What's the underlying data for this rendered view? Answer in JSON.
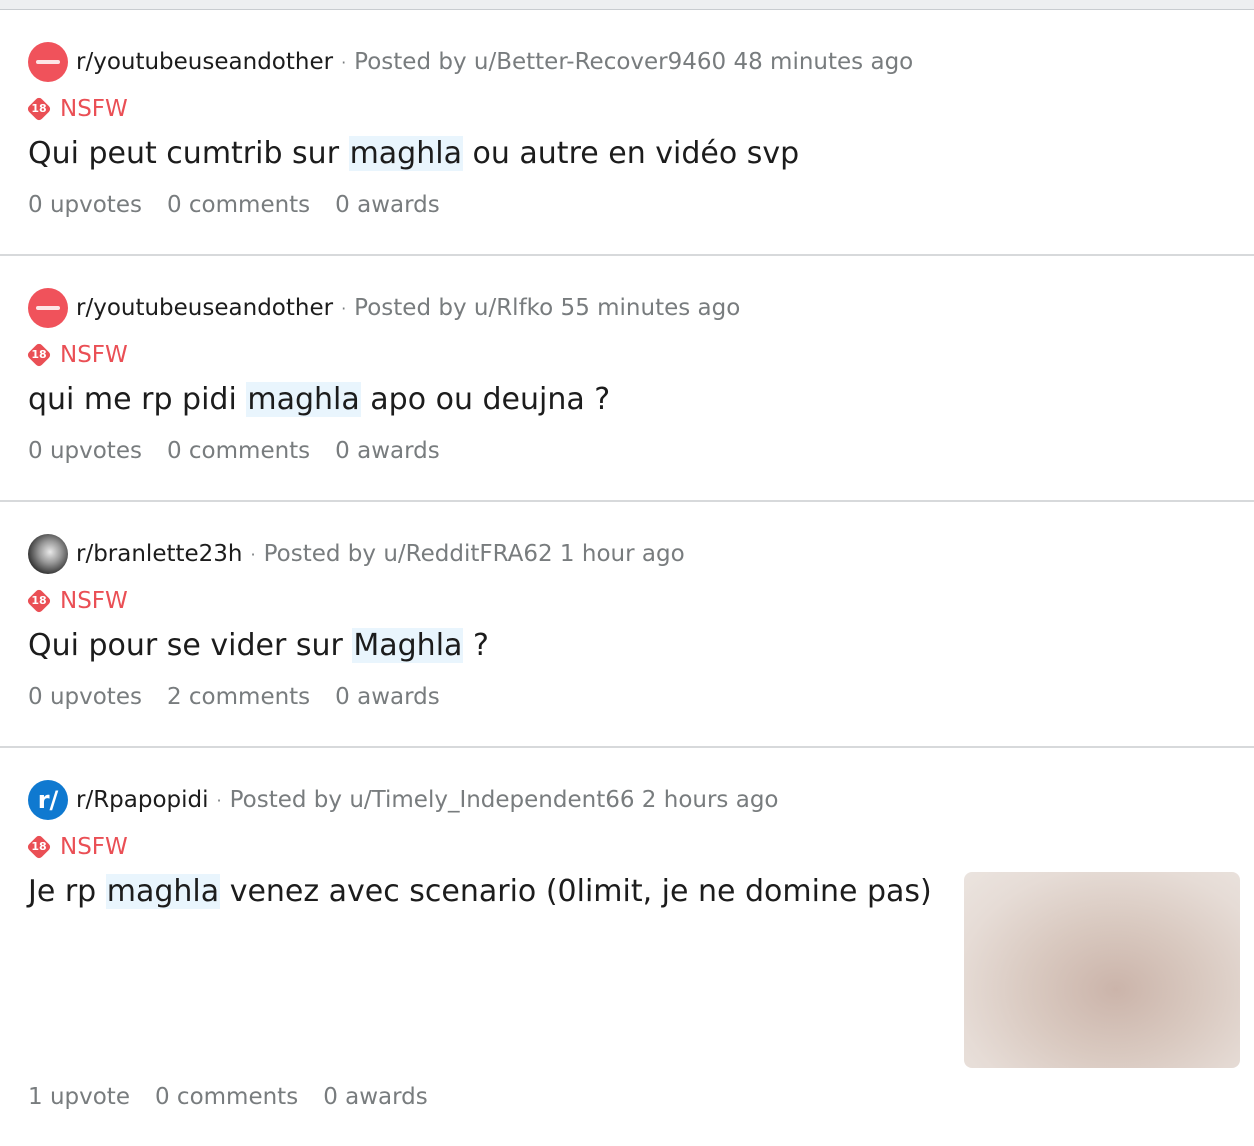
{
  "posts": [
    {
      "subreddit": "r/youtubeuseandother",
      "posted_by": "Posted by u/Better-Recover9460 48 minutes ago",
      "nsfw_badge": "18",
      "nsfw_label": "NSFW",
      "title_before": "Qui peut cumtrib sur ",
      "title_highlight": "maghla",
      "title_after": " ou autre en vidéo svp",
      "upvotes": "0 upvotes",
      "comments": "0 comments",
      "awards": "0 awards",
      "avatar_color": "#f0525b"
    },
    {
      "subreddit": "r/youtubeuseandother",
      "posted_by": "Posted by u/Rlfko 55 minutes ago",
      "nsfw_badge": "18",
      "nsfw_label": "NSFW",
      "title_before": "qui me rp pidi ",
      "title_highlight": "maghla",
      "title_after": " apo ou deujna ?",
      "upvotes": "0 upvotes",
      "comments": "0 comments",
      "awards": "0 awards",
      "avatar_color": "#f0525b"
    },
    {
      "subreddit": "r/branlette23h",
      "posted_by": "Posted by u/RedditFRA62 1 hour ago",
      "nsfw_badge": "18",
      "nsfw_label": "NSFW",
      "title_before": "Qui pour se vider sur ",
      "title_highlight": "Maghla",
      "title_after": " ?",
      "upvotes": "0 upvotes",
      "comments": "2 comments",
      "awards": "0 awards",
      "avatar_color": "#3a3a3a"
    },
    {
      "subreddit": "r/Rpapopidi",
      "posted_by": "Posted by u/Timely_Independent66 2 hours ago",
      "nsfw_badge": "18",
      "nsfw_label": "NSFW",
      "title_before": "Je rp ",
      "title_highlight": "maghla",
      "title_after": " venez avec scenario (0limit, je ne domine pas)",
      "upvotes": "1 upvote",
      "comments": "0 comments",
      "awards": "0 awards",
      "avatar_color": "#0f79d0",
      "avatar_text": "r/"
    }
  ],
  "colors": {
    "nsfw": "#ea4f55",
    "highlight": "#e9f5fd",
    "meta_gray": "#787c7e",
    "divider": "#d7d9db"
  }
}
